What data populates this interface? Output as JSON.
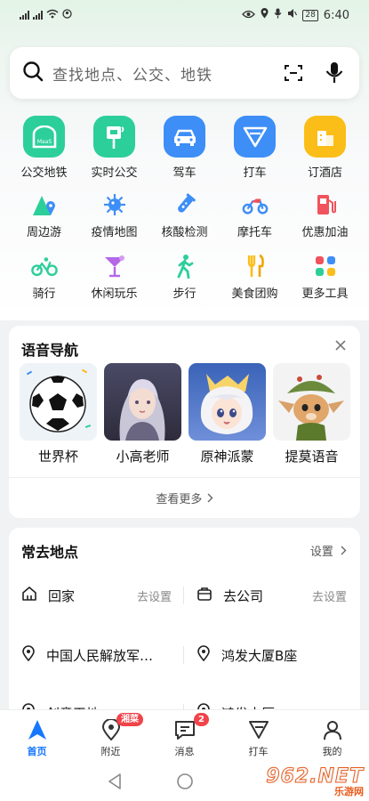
{
  "status_bar": {
    "time": "6:40",
    "battery": "28"
  },
  "search": {
    "placeholder": "查找地点、公交、地铁"
  },
  "grid": [
    {
      "label": "公交地铁",
      "icon": "metro-icon",
      "color": "#2ccf9a"
    },
    {
      "label": "实时公交",
      "icon": "bus-stop-icon",
      "color": "#2ccf9a"
    },
    {
      "label": "驾车",
      "icon": "car-icon",
      "color": "#3d8ef7"
    },
    {
      "label": "打车",
      "icon": "taxi-icon",
      "color": "#3d8ef7"
    },
    {
      "label": "订酒店",
      "icon": "hotel-icon",
      "color": "#fbbd18"
    },
    {
      "label": "周边游",
      "icon": "mountain-icon",
      "color": "#2ccf9a"
    },
    {
      "label": "疫情地图",
      "icon": "virus-icon",
      "color": "#3d8ef7"
    },
    {
      "label": "核酸检测",
      "icon": "test-tube-icon",
      "color": "#3d8ef7"
    },
    {
      "label": "摩托车",
      "icon": "motorcycle-icon",
      "color": "#3d8ef7"
    },
    {
      "label": "优惠加油",
      "icon": "gas-pump-icon",
      "color": "#f0535b"
    },
    {
      "label": "骑行",
      "icon": "bicycle-icon",
      "color": "#2ccf9a"
    },
    {
      "label": "休闲玩乐",
      "icon": "cocktail-icon",
      "color": "#b467e8"
    },
    {
      "label": "步行",
      "icon": "walk-icon",
      "color": "#2ccf9a"
    },
    {
      "label": "美食团购",
      "icon": "food-icon",
      "color": "#fbbd18"
    },
    {
      "label": "更多工具",
      "icon": "more-tools-icon",
      "color": "#3d8ef7"
    }
  ],
  "voice_nav": {
    "title": "语音导航",
    "items": [
      {
        "name": "世界杯",
        "icon": "soccer-ball-image"
      },
      {
        "name": "小高老师",
        "icon": "character-portrait-image"
      },
      {
        "name": "原神派蒙",
        "icon": "paimon-image"
      },
      {
        "name": "提莫语音",
        "icon": "teemo-image"
      }
    ],
    "see_more": "查看更多"
  },
  "places": {
    "title": "常去地点",
    "settings": "设置",
    "rows": [
      [
        {
          "name": "回家",
          "icon": "home-icon",
          "action": "去设置"
        },
        {
          "name": "去公司",
          "icon": "briefcase-icon",
          "action": "去设置"
        }
      ],
      [
        {
          "name": "中国人民解放军…",
          "icon": "location-pin-icon",
          "action": ""
        },
        {
          "name": "鸿发大厦B座",
          "icon": "location-pin-icon",
          "action": ""
        }
      ],
      [
        {
          "name": "创意天地",
          "icon": "location-pin-icon",
          "action": ""
        },
        {
          "name": "鸿发大厦",
          "icon": "location-pin-icon",
          "action": ""
        }
      ]
    ]
  },
  "bottom_nav": [
    {
      "label": "首页",
      "icon": "home-arrow-icon",
      "active": true,
      "badge": ""
    },
    {
      "label": "附近",
      "icon": "nearby-icon",
      "active": false,
      "badge": "湘菜"
    },
    {
      "label": "消息",
      "icon": "message-icon",
      "active": false,
      "badge": "2"
    },
    {
      "label": "打车",
      "icon": "taxi-nav-icon",
      "active": false,
      "badge": ""
    },
    {
      "label": "我的",
      "icon": "profile-icon",
      "active": false,
      "badge": ""
    }
  ],
  "watermark": {
    "number": "962.NET",
    "subtitle": "乐游网"
  },
  "colors": {
    "accent": "#1677ff",
    "badge": "#f0434a"
  }
}
